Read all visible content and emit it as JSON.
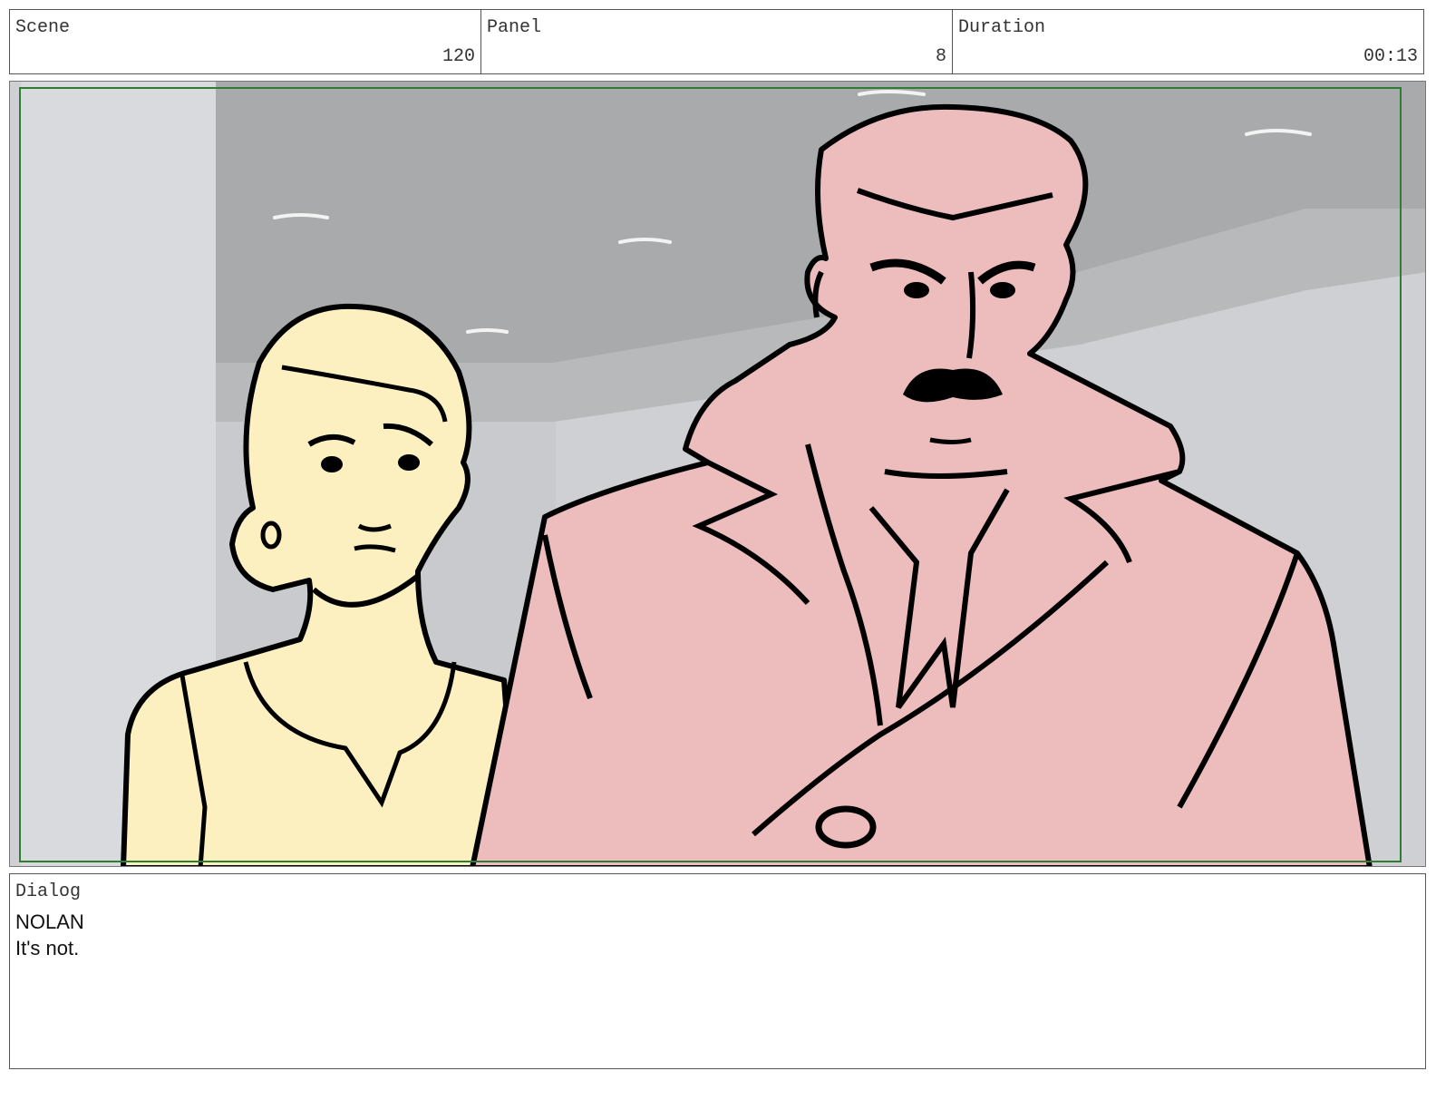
{
  "header": {
    "scene_label": "Scene",
    "scene_value": "120",
    "panel_label": "Panel",
    "panel_value": "8",
    "duration_label": "Duration",
    "duration_value": "00:13"
  },
  "dialog": {
    "label": "Dialog",
    "character": "NOLAN",
    "line": "It's not."
  },
  "colors": {
    "safe_frame": "#2e7d32",
    "woman_fill": "#fdf0c0",
    "man_fill": "#edbcbc"
  }
}
